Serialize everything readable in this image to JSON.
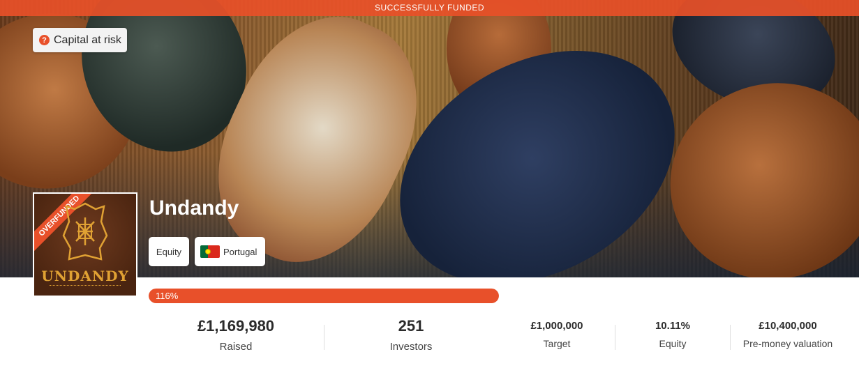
{
  "banner": {
    "text": "SUCCESSFULLY FUNDED"
  },
  "capital_risk": {
    "label": "Capital at risk",
    "icon": "question-circle-icon"
  },
  "logo": {
    "ribbon": "OVERFUNDED",
    "wordmark": "UNDANDY"
  },
  "company": {
    "name": "Undandy"
  },
  "tags": [
    {
      "label": "Equity"
    },
    {
      "label": "Portugal",
      "icon": "portugal-flag-icon"
    }
  ],
  "progress": {
    "label": "116%",
    "fraction": 1.0
  },
  "stats": [
    {
      "value": "£1,169,980",
      "label": "Raised"
    },
    {
      "value": "251",
      "label": "Investors"
    },
    {
      "value": "£1,000,000",
      "label": "Target"
    },
    {
      "value": "10.11%",
      "label": "Equity"
    },
    {
      "value": "£10,400,000",
      "label": "Pre-money valuation"
    }
  ],
  "colors": {
    "accent": "#e8502a",
    "text": "#2b2b2b",
    "logo_gold": "#e0a133"
  }
}
